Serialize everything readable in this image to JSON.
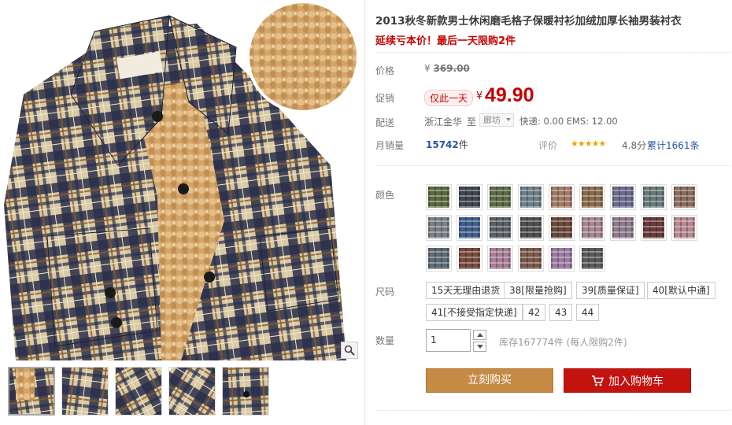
{
  "product": {
    "title": "2013秋冬新款男士休闲磨毛格子保暖衬衫加绒加厚长袖男装衬衣",
    "promo_subtitle": "延续亏本价！最后一天限购2件"
  },
  "labels": {
    "price": "价格",
    "promo": "促销",
    "delivery": "配送",
    "monthly_sales": "月销量",
    "rating": "评价",
    "color": "颜色",
    "size": "尺码",
    "quantity": "数量"
  },
  "pricing": {
    "currency_symbol": "¥",
    "original_price": "369.00",
    "promo_badge": "仅此一天",
    "promo_price": "49.90"
  },
  "delivery": {
    "origin": "浙江金华",
    "to": "至",
    "destination": "廊坊",
    "shipping_text": "快递: 0.00 EMS: 12.00"
  },
  "sales": {
    "count": "15742",
    "unit": "件"
  },
  "rating": {
    "stars": "★★★★★",
    "score": "4.8分",
    "reviews": "累计1661条"
  },
  "colors": {
    "swatch_count": 24,
    "accent_colors": [
      "#5b6a3e",
      "#3f4652",
      "#5a6b45",
      "#6e7e88",
      "#a27a64",
      "#8a6a4a",
      "#6c6a8e",
      "#67797a",
      "#8a6b5e",
      "#7a7f86",
      "#3f5f8c",
      "#5a5f67",
      "#4f4f4f",
      "#6a4a3a",
      "#a7858f",
      "#8e7a8a",
      "#6a3a3a",
      "#b78890",
      "#5e6a74",
      "#7a4a3e",
      "#a77d96",
      "#7a5a4a",
      "#9a7aa0",
      "#5a5a5a"
    ]
  },
  "sizes": {
    "options": [
      "15天无理由退货",
      "38[限量抢购]",
      "39[质量保证]",
      "40[默认中通]",
      "41[不接受指定快递]",
      "42",
      "43",
      "44"
    ]
  },
  "quantity": {
    "value": "1",
    "stock_text": "库存167774件  (每人限购2件)"
  },
  "actions": {
    "buy_now": "立刻购买",
    "add_to_cart": "加入购物车"
  },
  "gallery": {
    "thumbnail_count": 5,
    "selected_index": 0
  },
  "theme": {
    "price_red": "#c40000",
    "link_blue": "#2953a6",
    "buy_button": "#c68a45",
    "cart_button": "#c4120f"
  }
}
